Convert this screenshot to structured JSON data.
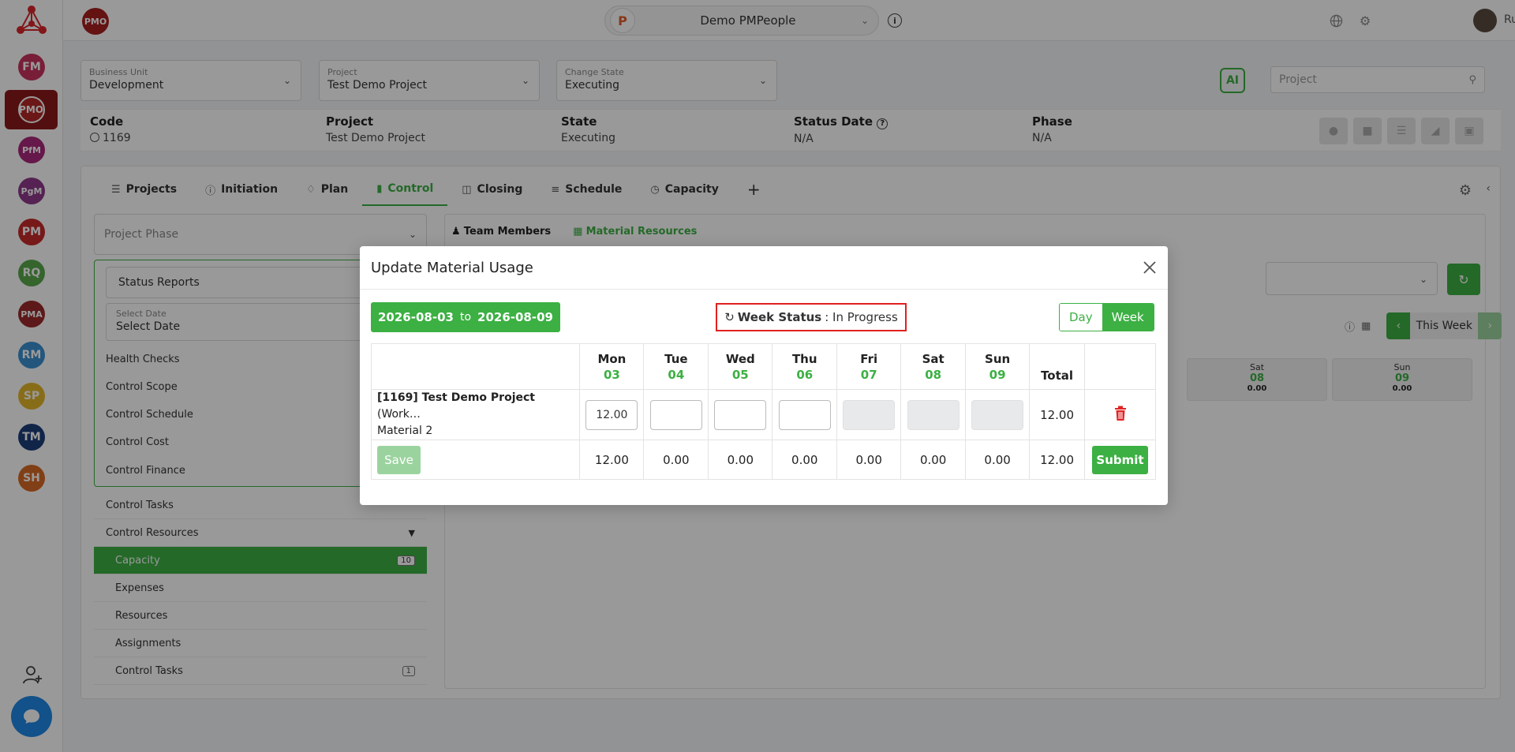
{
  "topbar": {
    "pmo_badge": "PMO",
    "org_name": "Demo PMPeople",
    "user_name": "Rushikesh"
  },
  "rail": {
    "modules": [
      "FM",
      "PMO",
      "PfM",
      "PgM",
      "PM",
      "RQ",
      "PMA",
      "RM",
      "SP",
      "TM",
      "SH"
    ],
    "colors": [
      "#c8325e",
      "#b52727",
      "#a8287a",
      "#8e3a8a",
      "#c72a2a",
      "#59a84b",
      "#9b2a2a",
      "#3b8fd1",
      "#e3b62a",
      "#1d3f7a",
      "#d86a25"
    ]
  },
  "filters": {
    "business_unit": {
      "label": "Business Unit",
      "value": "Development"
    },
    "project": {
      "label": "Project",
      "value": "Test Demo Project"
    },
    "change_state": {
      "label": "Change State",
      "value": "Executing"
    },
    "search_placeholder": "Project"
  },
  "info": {
    "code_h": "Code",
    "code_v": "1169",
    "project_h": "Project",
    "project_v": "Test Demo Project",
    "state_h": "State",
    "state_v": "Executing",
    "status_date_h": "Status Date",
    "status_date_v": "N/A",
    "phase_h": "Phase",
    "phase_v": "N/A"
  },
  "tabs": [
    "Projects",
    "Initiation",
    "Plan",
    "Control",
    "Closing",
    "Schedule",
    "Capacity"
  ],
  "sidebar": {
    "phase_placeholder": "Project Phase",
    "status_reports": "Status Reports",
    "select_date_label": "Select Date",
    "select_date_value": "Select Date",
    "group_items": [
      "Health Checks",
      "Control Scope",
      "Control Schedule",
      "Control Cost",
      "Control Finance"
    ],
    "control_tasks": "Control Tasks",
    "control_resources": "Control Resources",
    "sub_items": [
      {
        "label": "Capacity",
        "count": "10"
      },
      {
        "label": "Expenses",
        "count": ""
      },
      {
        "label": "Resources",
        "count": ""
      },
      {
        "label": "Assignments",
        "count": ""
      },
      {
        "label": "Control Tasks",
        "count": "1"
      }
    ]
  },
  "right": {
    "tab_team": "Team Members",
    "tab_material": "Material Resources",
    "week_label": "This Week",
    "cards": [
      {
        "day": "Sat",
        "num": "08",
        "val": "0.00"
      },
      {
        "day": "Sun",
        "num": "09",
        "val": "0.00"
      }
    ]
  },
  "modal": {
    "title": "Update Material Usage",
    "range_start": "2026-08-03",
    "range_to": "to",
    "range_end": "2026-08-09",
    "week_status_label": "Week Status",
    "week_status_value": ": In Progress",
    "toggle_day": "Day",
    "toggle_week": "Week",
    "days": [
      {
        "name": "Mon",
        "num": "03"
      },
      {
        "name": "Tue",
        "num": "04"
      },
      {
        "name": "Wed",
        "num": "05"
      },
      {
        "name": "Thu",
        "num": "06"
      },
      {
        "name": "Fri",
        "num": "07"
      },
      {
        "name": "Sat",
        "num": "08"
      },
      {
        "name": "Sun",
        "num": "09"
      }
    ],
    "total_header": "Total",
    "row_title_bold": "[1169] Test Demo Project",
    "row_title_rest": " (Work…",
    "row_title_line2": "Material 2",
    "inputs": [
      "12.00",
      "",
      "",
      "",
      "",
      "",
      ""
    ],
    "row_total": "12.00",
    "save_label": "Save",
    "sums": [
      "12.00",
      "0.00",
      "0.00",
      "0.00",
      "0.00",
      "0.00",
      "0.00"
    ],
    "grand_total": "12.00",
    "submit_label": "Submit"
  }
}
